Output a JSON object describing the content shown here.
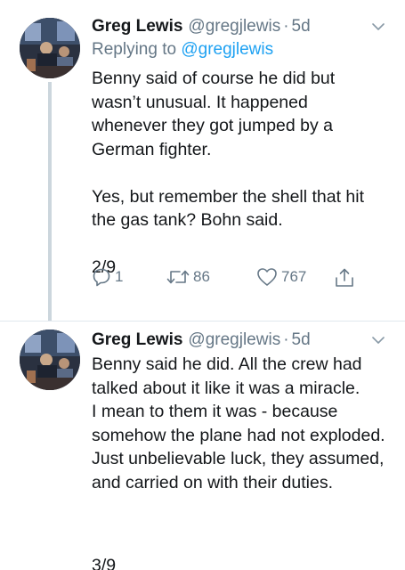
{
  "tweets": [
    {
      "name": "Greg Lewis",
      "handle": "@gregjlewis",
      "separator": "·",
      "time": "5d",
      "reply_prefix": "Replying to",
      "reply_mention": "@gregjlewis",
      "paragraphs": [
        "Benny said of course he did but wasn’t unusual. It happened whenever they got jumped by a German fighter.",
        "Yes, but remember the shell that hit the gas tank? Bohn said."
      ],
      "counter": "2/9",
      "replies": "1",
      "retweets": "86",
      "likes": "767"
    },
    {
      "name": "Greg Lewis",
      "handle": "@gregjlewis",
      "separator": "·",
      "time": "5d",
      "lines": [
        "Benny said he did. All the crew had talked about it like it was a miracle.",
        "I mean to them it was - because somehow the plane had not exploded.",
        "Just unbelievable luck, they assumed, and carried on with their duties."
      ],
      "counter": "3/9"
    }
  ],
  "icons": {
    "reply": "reply-icon",
    "retweet": "retweet-icon",
    "like": "heart-icon",
    "share": "share-icon",
    "menu": "chevron-down-icon"
  },
  "colors": {
    "accent": "#1da1f2",
    "secondary_text": "#657786",
    "thread_line": "#ccd6dd"
  }
}
